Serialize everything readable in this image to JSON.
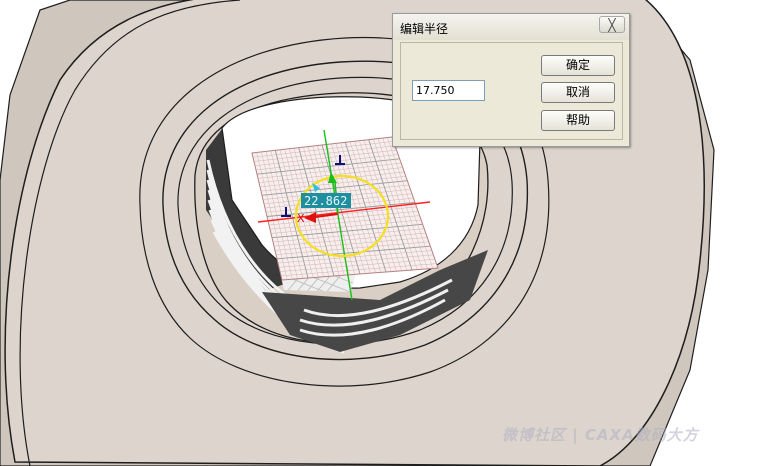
{
  "dialog": {
    "title": "编辑半径",
    "close_label": "╳",
    "radius_value": "17.750",
    "ok_label": "确定",
    "cancel_label": "取消",
    "help_label": "帮助"
  },
  "viewport": {
    "dimension_label": "22.862",
    "axis_label": "X"
  },
  "watermark": "微博社区 | CAXA数码大方",
  "colors": {
    "part_face": "#dcd3ca",
    "edge": "#1e1e1e",
    "sketch_circle": "#f4e020",
    "x_axis": "#ff2020",
    "y_axis": "#18c018",
    "dimension_bg": "#1f8fa0"
  }
}
